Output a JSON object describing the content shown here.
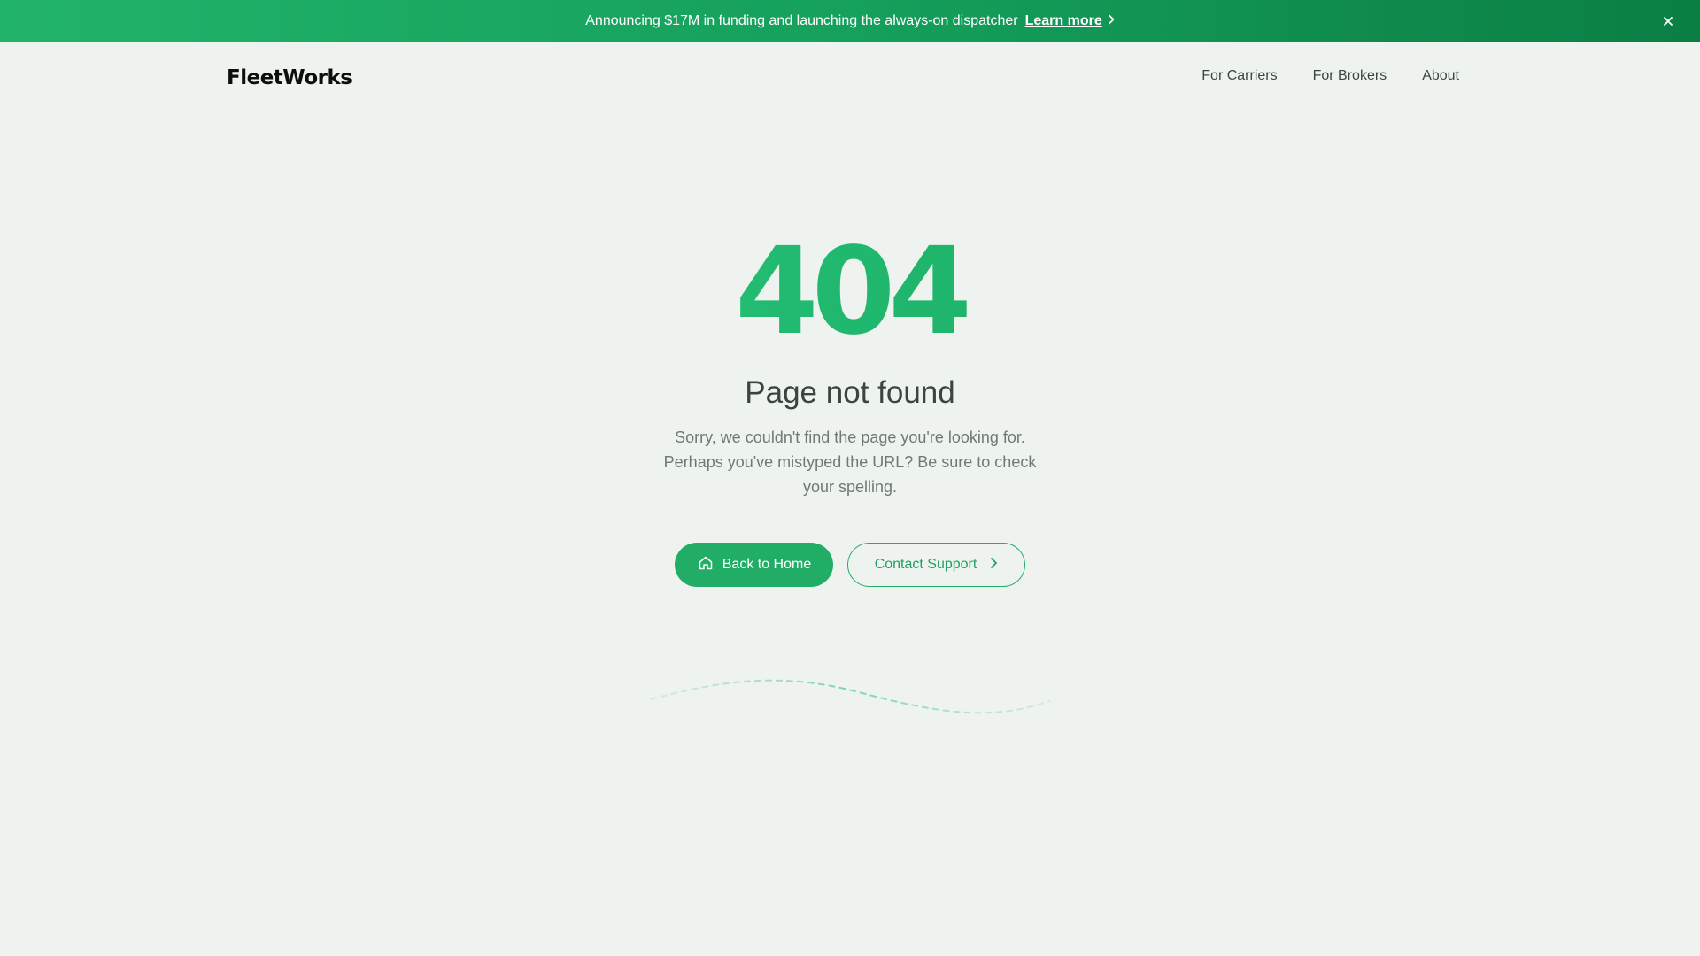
{
  "announcement": {
    "text": "Announcing $17M in funding and launching the always-on dispatcher",
    "link_label": "Learn more",
    "link_icon": "chevron-right-icon",
    "close_icon": "close-icon"
  },
  "header": {
    "logo_text": "FleetWorks",
    "nav": [
      {
        "label": "For Carriers"
      },
      {
        "label": "For Brokers"
      },
      {
        "label": "About"
      }
    ]
  },
  "main": {
    "code": "404",
    "title": "Page not found",
    "description": "Sorry, we couldn't find the page you're looking for. Perhaps you've mistyped the URL? Be sure to check your spelling.",
    "primary_button": {
      "label": "Back to Home",
      "icon": "home-icon"
    },
    "secondary_button": {
      "label": "Contact Support",
      "icon": "chevron-right-icon"
    }
  },
  "colors": {
    "accent": "#22ad67",
    "background": "#eff3ef",
    "heading": "#3b4540",
    "body_text": "#6f7a74"
  }
}
